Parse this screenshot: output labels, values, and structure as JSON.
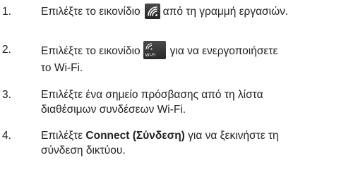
{
  "steps": [
    {
      "number": "1.",
      "before": "Επιλέξτε το εικονίδιο",
      "icon": "wifi-taskbar-icon",
      "after": "από τη γραμμή εργασιών."
    },
    {
      "number": "2.",
      "before": "Επιλέξτε το εικονίδιο",
      "icon": "wifi-quick-action-tile",
      "icon_label": "Wi-Fi",
      "after_line1": "για να ενεργοποιήσετε",
      "after_line2": "το Wi-Fi."
    },
    {
      "number": "3.",
      "line1": "Επιλέξτε ένα σημείο πρόσβασης από τη λίστα",
      "line2": "διαθέσιμων συνδέσεων Wi-Fi."
    },
    {
      "number": "4.",
      "before": "Επιλέξτε",
      "bold": "Connect (Σύνδεση)",
      "after_line1": "για να ξεκινήστε τη",
      "after_line2": "σύνδεση δικτύου."
    }
  ]
}
